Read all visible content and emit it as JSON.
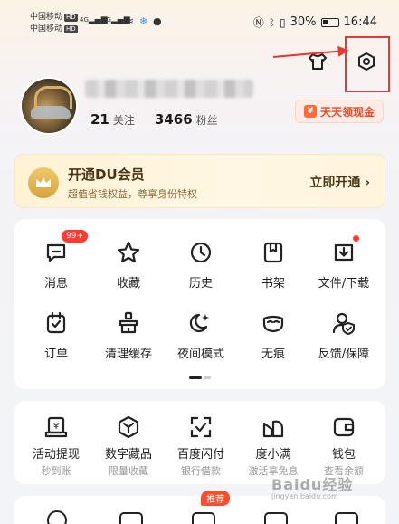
{
  "status_bar": {
    "carrier1": "中国移动",
    "carrier2": "中国移动",
    "hd": "HD",
    "sig1": "4G",
    "sig2": "5G",
    "battery": "30%",
    "time": "16:44"
  },
  "profile": {
    "following_count": "21",
    "following_label": "关注",
    "fans_count": "3466",
    "fans_label": "粉丝",
    "cash_button": "天天领现金"
  },
  "vip": {
    "title": "开通DU会员",
    "subtitle": "超值省钱权益，尊享身份特权",
    "cta": "立即开通 ›"
  },
  "grid1": [
    {
      "label": "消息",
      "icon": "message-icon",
      "badge": "99+"
    },
    {
      "label": "收藏",
      "icon": "star-icon"
    },
    {
      "label": "历史",
      "icon": "clock-icon"
    },
    {
      "label": "书架",
      "icon": "bookshelf-icon"
    },
    {
      "label": "文件/下载",
      "icon": "download-icon",
      "dot": true
    },
    {
      "label": "订单",
      "icon": "order-icon"
    },
    {
      "label": "清理缓存",
      "icon": "broom-icon"
    },
    {
      "label": "夜间模式",
      "icon": "moon-icon"
    },
    {
      "label": "无痕",
      "icon": "mask-icon"
    },
    {
      "label": "反馈/保障",
      "icon": "feedback-icon"
    }
  ],
  "grid2": [
    {
      "label": "活动提现",
      "sub": "秒到账",
      "icon": "yuan-card-icon"
    },
    {
      "label": "数字藏品",
      "sub": "限量收藏",
      "icon": "cube-icon"
    },
    {
      "label": "百度闪付",
      "sub": "银行借款",
      "icon": "scan-check-icon"
    },
    {
      "label": "度小满",
      "sub": "激活享免息",
      "icon": "duxiaoman-icon"
    },
    {
      "label": "钱包",
      "sub": "查看余额",
      "icon": "wallet-icon"
    }
  ],
  "grid3": {
    "tag": "推荐"
  },
  "watermark": {
    "main": "Baidu经验",
    "sub": "jingyan.baidu.com"
  },
  "colors": {
    "accent": "#ff3b30",
    "annotation": "#e23a3a",
    "vip_text": "#4a3418"
  }
}
